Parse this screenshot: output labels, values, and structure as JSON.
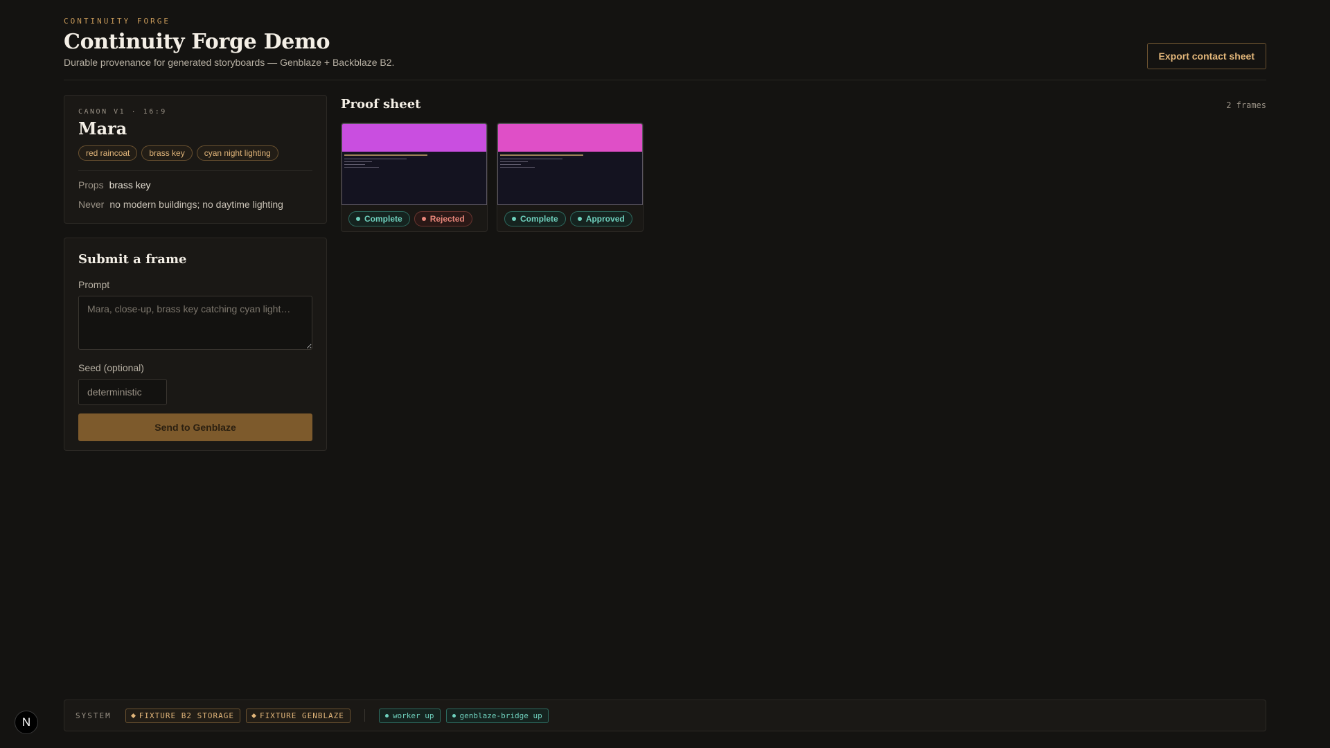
{
  "header": {
    "eyebrow": "CONTINUITY FORGE",
    "title": "Continuity Forge Demo",
    "subtitle": "Durable provenance for generated storyboards — Genblaze + Backblaze B2.",
    "export_label": "Export contact sheet"
  },
  "canon": {
    "meta": "CANON V1 · 16:9",
    "name": "Mara",
    "tags": [
      "red raincoat",
      "brass key",
      "cyan night lighting"
    ],
    "props_label": "Props",
    "props_value": "brass key",
    "never_label": "Never",
    "never_value": "no modern buildings; no daytime lighting"
  },
  "submit": {
    "title": "Submit a frame",
    "prompt_label": "Prompt",
    "prompt_placeholder": "Mara, close-up, brass key catching cyan light…",
    "seed_label": "Seed (optional)",
    "seed_placeholder": "deterministic",
    "send_label": "Send to Genblaze"
  },
  "proof": {
    "title": "Proof sheet",
    "count": "2 frames",
    "frames": [
      {
        "band_color": "#c94ee0",
        "status": "Complete",
        "review": "Rejected"
      },
      {
        "band_color": "#df4fc7",
        "status": "Complete",
        "review": "Approved"
      }
    ]
  },
  "system": {
    "label": "SYSTEM",
    "fixtures": [
      "FIXTURE B2 STORAGE",
      "FIXTURE GENBLAZE"
    ],
    "services": [
      "worker up",
      "genblaze-bridge up"
    ]
  },
  "corner_badge": "N"
}
